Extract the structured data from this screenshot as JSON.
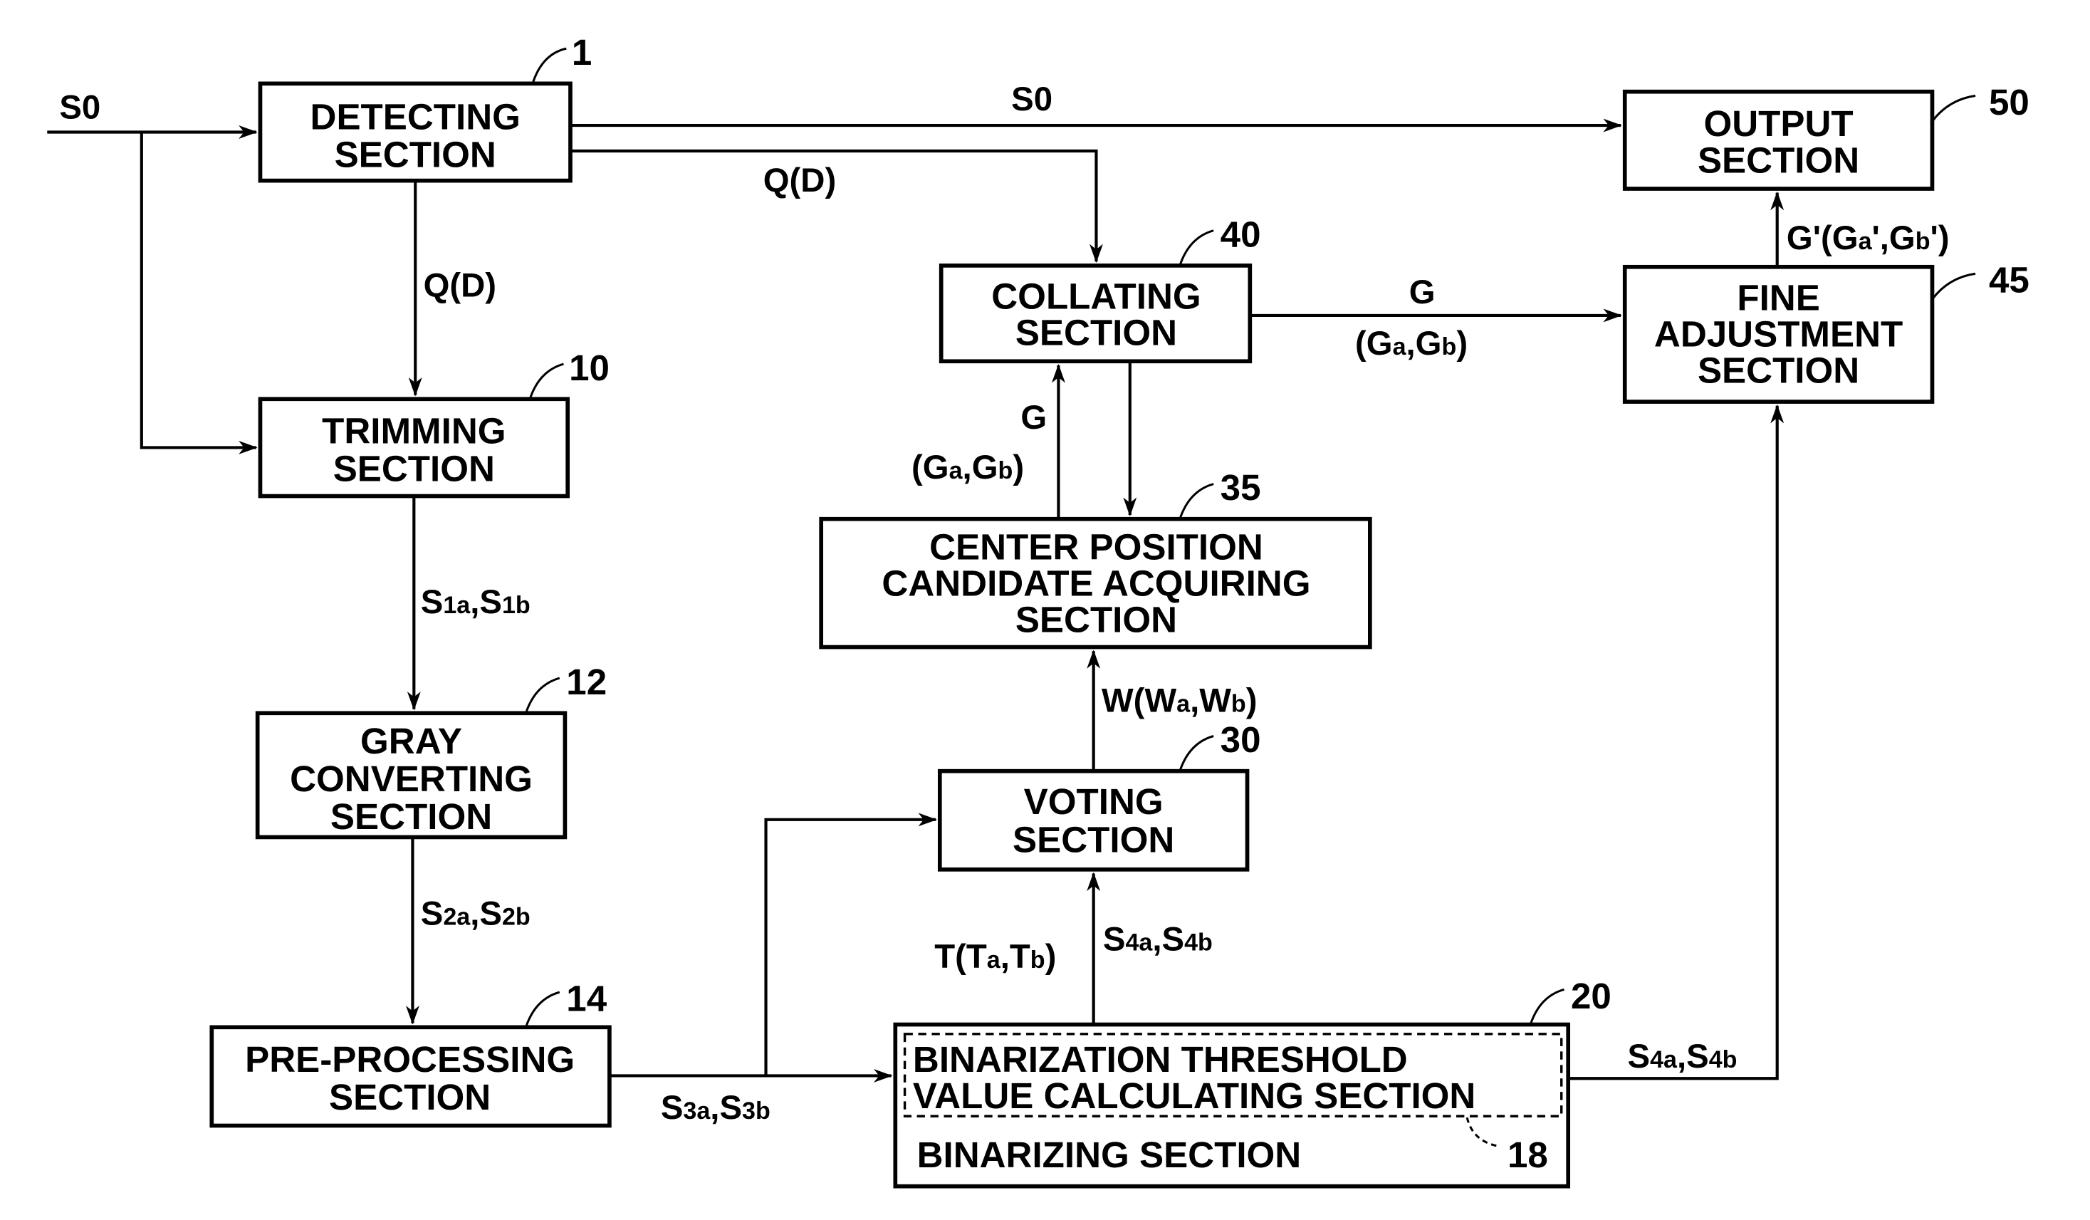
{
  "boxes": {
    "detecting": {
      "lines": [
        "DETECTING",
        "SECTION"
      ],
      "ref": "1"
    },
    "output": {
      "lines": [
        "OUTPUT",
        "SECTION"
      ],
      "ref": "50"
    },
    "trimming": {
      "lines": [
        "TRIMMING",
        "SECTION"
      ],
      "ref": "10"
    },
    "gray": {
      "lines": [
        "GRAY",
        "CONVERTING",
        "SECTION"
      ],
      "ref": "12"
    },
    "preprocessing": {
      "lines": [
        "PRE-PROCESSING",
        "SECTION"
      ],
      "ref": "14"
    },
    "collating": {
      "lines": [
        "COLLATING",
        "SECTION"
      ],
      "ref": "40"
    },
    "fine": {
      "lines": [
        "FINE",
        "ADJUSTMENT",
        "SECTION"
      ],
      "ref": "45"
    },
    "center": {
      "lines": [
        "CENTER POSITION",
        "CANDIDATE ACQUIRING",
        "SECTION"
      ],
      "ref": "35"
    },
    "voting": {
      "lines": [
        "VOTING",
        "SECTION"
      ],
      "ref": "30"
    },
    "binarizing": {
      "inner_lines": [
        "BINARIZATION THRESHOLD",
        "VALUE CALCULATING SECTION"
      ],
      "inner_ref": "18",
      "label": "BINARIZING SECTION",
      "ref": "20"
    }
  },
  "signals": {
    "s0_in": "S0",
    "s0_top": "S0",
    "qd_down": "Q(D)",
    "qd_right": "Q(D)",
    "s1": {
      "base1": "S",
      "sub1": "1a",
      "sep": ",",
      "base2": "S",
      "sub2": "1b"
    },
    "s2": {
      "base1": "S",
      "sub1": "2a",
      "sep": ",",
      "base2": "S",
      "sub2": "2b"
    },
    "s3": {
      "base1": "S",
      "sub1": "3a",
      "sep": ",",
      "base2": "S",
      "sub2": "3b"
    },
    "s4_up": {
      "base1": "S",
      "sub1": "4a",
      "sep": ",",
      "base2": "S",
      "sub2": "4b"
    },
    "s4_right": {
      "base1": "S",
      "sub1": "4a",
      "sep": ",",
      "base2": "S",
      "sub2": "4b"
    },
    "t": {
      "pre": "T(T",
      "sub1": "a",
      "mid": ",T",
      "sub2": "b",
      "post": ")"
    },
    "w": {
      "pre": "W(W",
      "sub1": "a",
      "mid": ",W",
      "sub2": "b",
      "post": ")"
    },
    "g_right": {
      "top": "G",
      "pre": "(G",
      "sub1": "a",
      "mid": ",G",
      "sub2": "b",
      "post": ")"
    },
    "g_up": {
      "top": "G",
      "pre": "(G",
      "sub1": "a",
      "mid": ",G",
      "sub2": "b",
      "post": ")"
    },
    "g_prime": {
      "pre": "G'(G",
      "sub1": "a",
      "mid": "',G",
      "sub2": "b",
      "post": "')"
    }
  }
}
